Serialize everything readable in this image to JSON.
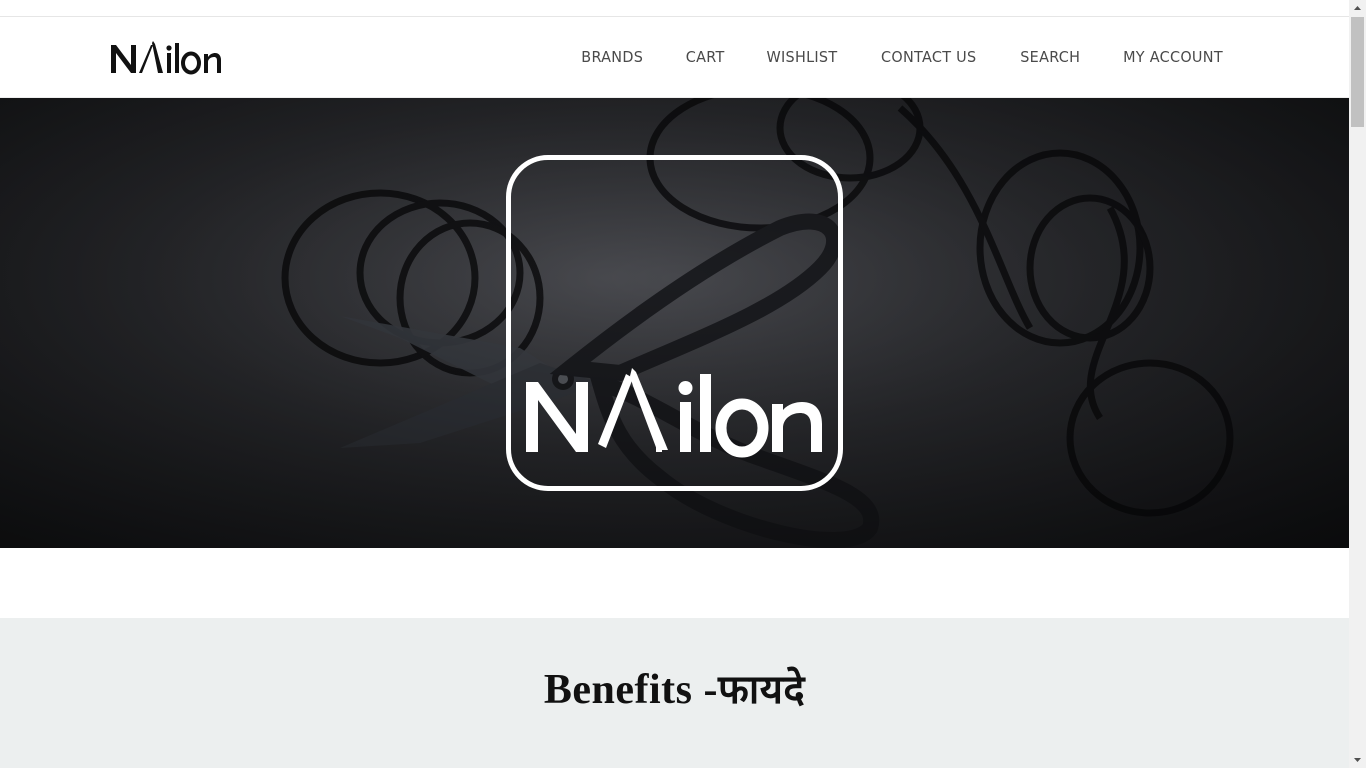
{
  "brand": {
    "logo_text": "NAilon"
  },
  "nav": {
    "items": [
      {
        "label": "BRANDS"
      },
      {
        "label": "CART"
      },
      {
        "label": "WISHLIST"
      },
      {
        "label": "CONTACT US"
      },
      {
        "label": "SEARCH"
      },
      {
        "label": "MY ACCOUNT"
      }
    ]
  },
  "hero": {
    "logo_text": "NAilon"
  },
  "benefits": {
    "title_en": "Benefits -",
    "title_hi": "फायदे"
  },
  "colors": {
    "accent": "#111111",
    "nav_text": "#4a4a4a",
    "section_bg": "#ecefef",
    "hero_bg": "#2f3034"
  },
  "icons": [
    "razor-logo-icon",
    "scroll-up-arrow-icon",
    "scroll-down-arrow-icon"
  ]
}
